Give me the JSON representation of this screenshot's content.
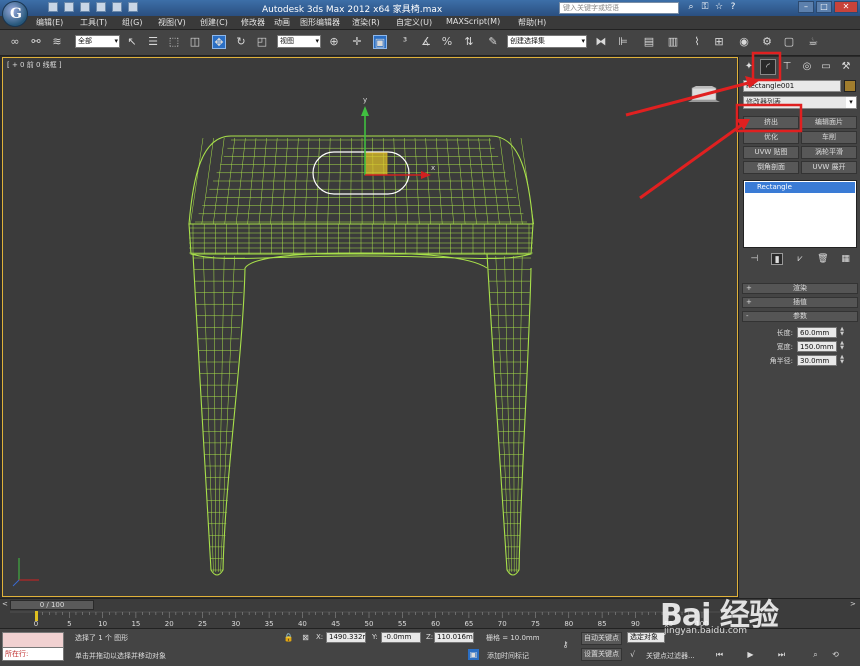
{
  "titlebar": {
    "window_title": "Autodesk 3ds Max  2012 x64       家具椅.max",
    "help_search_placeholder": "键入关键字或短语"
  },
  "menubar": {
    "items": [
      "编辑(E)",
      "工具(T)",
      "组(G)",
      "视图(V)",
      "创建(C)",
      "修改器",
      "动画",
      "图形编辑器",
      "渲染(R)",
      "自定义(U)",
      "MAXScript(M)",
      "帮助(H)"
    ]
  },
  "toolbar": {
    "selection_filter": "全部",
    "reference_coordinate": "视图",
    "named_selection_set": "创建选择集"
  },
  "viewport": {
    "label": "[ + 0 前 0 线框 ]",
    "gizmo_y_label": "y",
    "gizmo_x_label": "x"
  },
  "command_panel": {
    "object_name": "Rectangle001",
    "object_color": "#a07d2e",
    "modifier_list": "修改器列表",
    "modifier_buttons": [
      "挤出",
      "编辑面片",
      "优化",
      "车削",
      "UVW 贴图",
      "涡轮平滑",
      "倒角剖面",
      "UVW 展开"
    ],
    "stack_item": "Rectangle",
    "rollouts": [
      {
        "sign": "+",
        "label": "渲染"
      },
      {
        "sign": "+",
        "label": "插值"
      },
      {
        "sign": "-",
        "label": "参数"
      }
    ],
    "params": [
      {
        "label": "长度:",
        "value": "60.0mm"
      },
      {
        "label": "宽度:",
        "value": "150.0mm"
      },
      {
        "label": "角半径:",
        "value": "30.0mm"
      }
    ]
  },
  "timeline": {
    "frame_display": "0 / 100",
    "left_arrow": "<",
    "right_arrow": ">",
    "ticks": [
      "0",
      "5",
      "10",
      "15",
      "20",
      "25",
      "30",
      "35",
      "40",
      "45",
      "50",
      "55",
      "60",
      "65",
      "70",
      "75",
      "80",
      "85",
      "90",
      "95",
      "100"
    ]
  },
  "statusbar": {
    "maxscript_label": "所在行:",
    "status_text": "选择了 1 个 图形",
    "prompt_text": "单击并拖动以选择并移动对象",
    "x_label": "X:",
    "x_value": "1490.332m",
    "y_label": "Y:",
    "y_value": "-0.0mm",
    "z_label": "Z:",
    "z_value": "110.016mm",
    "grid_text": "栅格 = 10.0mm",
    "add_time_tag": "添加时间标记",
    "auto_key": "自动关键点",
    "selected_dropdown": "选定对象",
    "set_key": "设置关键点",
    "key_filters": "关键点过滤器..."
  },
  "watermark": {
    "logo": "Bai 经验",
    "url": "jingyan.baidu.com"
  },
  "colors": {
    "wireframe": "#a8e04a",
    "annotation": "#e02020",
    "highlight": "#e02020"
  }
}
